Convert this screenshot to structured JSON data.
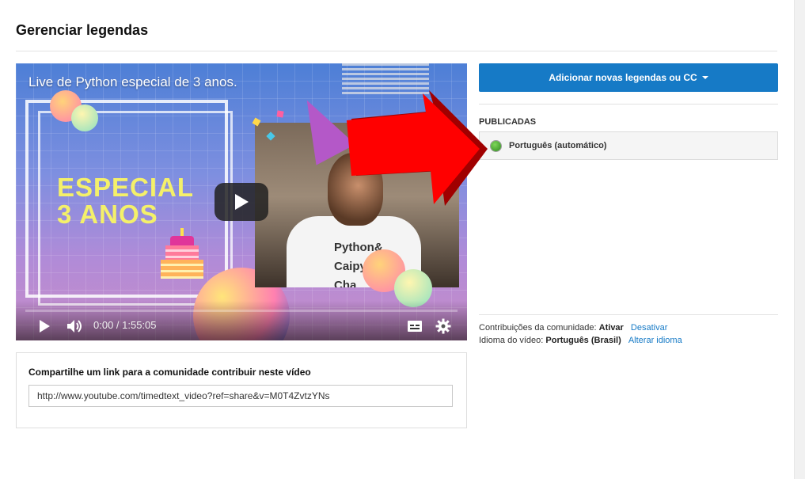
{
  "page": {
    "title": "Gerenciar legendas"
  },
  "video": {
    "title": "Live de Python especial de 3 anos.",
    "thumbnail_text": [
      "ESPECIAL",
      "3 ANOS"
    ],
    "shirt_text": [
      "Python&",
      "Caipy",
      "Cha"
    ],
    "time": "0:00 / 1:55:05",
    "progress": 0
  },
  "subtitles": {
    "add_button_label": "Adicionar novas legendas ou CC",
    "published_heading": "PUBLICADAS",
    "tracks": [
      {
        "label": "Português (automático)",
        "status_color": "#3cb521"
      }
    ]
  },
  "info": {
    "community_label": "Contribuições da comunidade:",
    "community_value": "Ativar",
    "community_link": "Desativar",
    "language_label": "Idioma do vídeo:",
    "language_value": "Português (Brasil)",
    "language_link": "Alterar idioma"
  },
  "share": {
    "title": "Compartilhe um link para a comunidade contribuir neste vídeo",
    "url": "http://www.youtube.com/timedtext_video?ref=share&v=M0T4ZvtzYNs"
  },
  "colors": {
    "accent": "#167ac6",
    "arrow": "#ff0000"
  }
}
